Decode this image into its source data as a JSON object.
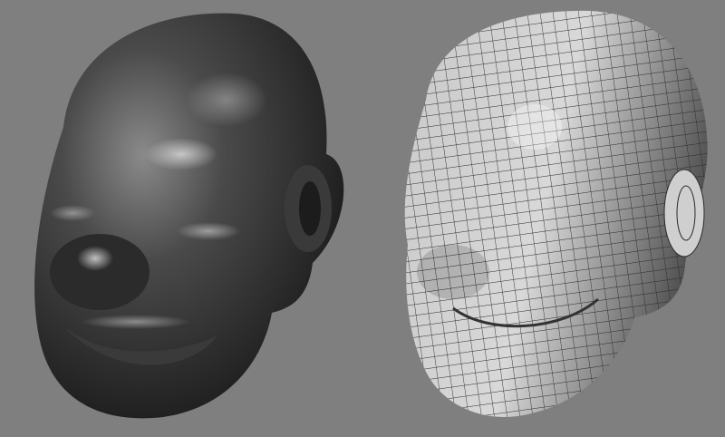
{
  "colors": {
    "background": "#7f7f7f",
    "smooth_head_dark": "#1e1e1e",
    "smooth_head_highlight": "#b5b5b5",
    "mesh_head_light": "#e8e8e8",
    "mesh_head_shadow": "#5a5a5a",
    "mesh_lines": "#2a2a2a"
  }
}
